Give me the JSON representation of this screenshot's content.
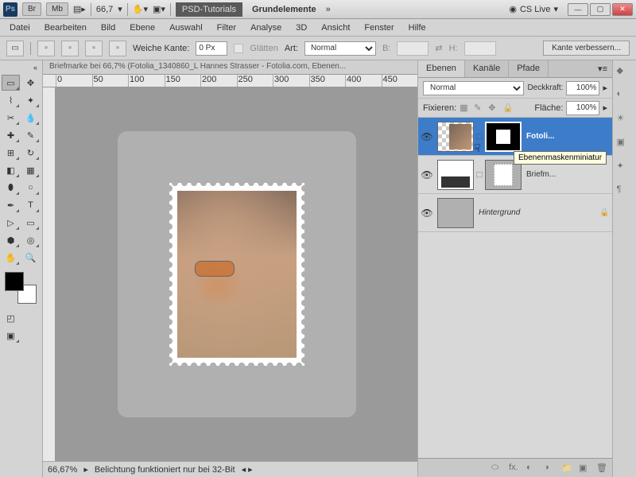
{
  "titlebar": {
    "zoom": "66,7",
    "psd_tutorials": "PSD-Tutorials",
    "grundelemente": "Grundelemente",
    "cslive": "CS Live"
  },
  "menu": [
    "Datei",
    "Bearbeiten",
    "Bild",
    "Ebene",
    "Auswahl",
    "Filter",
    "Analyse",
    "3D",
    "Ansicht",
    "Fenster",
    "Hilfe"
  ],
  "options": {
    "weiche_kante": "Weiche Kante:",
    "wk_val": "0 Px",
    "glaetten": "Glätten",
    "art": "Art:",
    "art_val": "Normal",
    "b": "B:",
    "h": "H:",
    "refine": "Kante verbessern..."
  },
  "doc_title": "Briefmarke bei 66,7% (Fotolia_1340860_L Hannes Strasser - Fotolia.com, Ebenen...",
  "ruler": [
    "0",
    "50",
    "100",
    "150",
    "200",
    "250",
    "300",
    "350",
    "400",
    "450"
  ],
  "status": {
    "zoom": "66,67%",
    "msg": "Belichtung funktioniert nur bei 32-Bit"
  },
  "panels": {
    "tabs": [
      "Ebenen",
      "Kanäle",
      "Pfade"
    ],
    "blend": "Normal",
    "opacity_lbl": "Deckkraft:",
    "opacity": "100%",
    "lock_lbl": "Fixieren:",
    "fill_lbl": "Fläche:",
    "fill": "100%",
    "layers": [
      {
        "name": "Fotoli...",
        "sel": true,
        "mask": true
      },
      {
        "name": "Briefm...",
        "sel": false,
        "mask": true
      },
      {
        "name": "Hintergrund",
        "sel": false,
        "bg": true
      }
    ],
    "tooltip": "Ebenenmaskenminiatur"
  },
  "icons": {
    "br": "Br",
    "mb": "Mb"
  }
}
